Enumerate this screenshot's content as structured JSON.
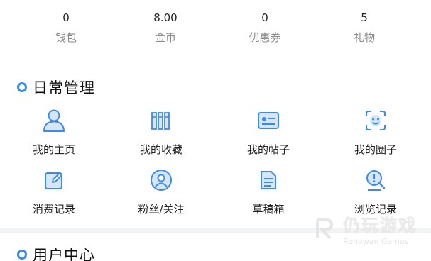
{
  "stats": [
    {
      "value": "0",
      "label": "钱包"
    },
    {
      "value": "8.00",
      "label": "金币"
    },
    {
      "value": "0",
      "label": "优惠券"
    },
    {
      "value": "5",
      "label": "礼物"
    }
  ],
  "daily": {
    "title": "日常管理",
    "items": [
      {
        "label": "我的主页",
        "icon": "user-icon"
      },
      {
        "label": "我的收藏",
        "icon": "bookshelf-icon"
      },
      {
        "label": "我的帖子",
        "icon": "id-card-icon"
      },
      {
        "label": "我的圈子",
        "icon": "face-scan-icon"
      },
      {
        "label": "消费记录",
        "icon": "edit-icon"
      },
      {
        "label": "粉丝/关注",
        "icon": "fans-icon"
      },
      {
        "label": "草稿箱",
        "icon": "draft-icon"
      },
      {
        "label": "浏览记录",
        "icon": "lightbulb-search-icon"
      }
    ]
  },
  "user_center": {
    "title": "用户中心"
  },
  "watermark": {
    "cn": "仍玩游戏",
    "en": "Renowan Games"
  },
  "colors": {
    "accent": "#3b8ce8",
    "icon_fill": "#d6e6f8"
  }
}
